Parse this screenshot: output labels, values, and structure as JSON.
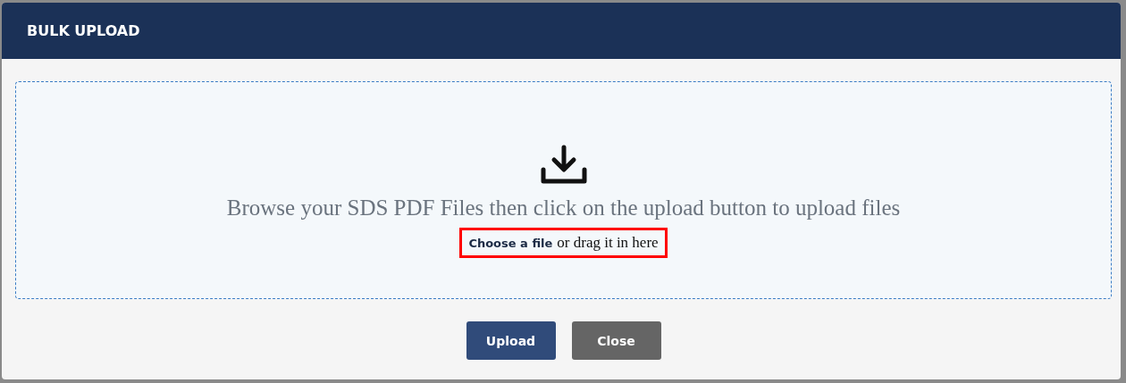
{
  "dialog": {
    "title": "BULK UPLOAD"
  },
  "dropzone": {
    "instruction": "Browse your SDS PDF Files then click on the upload button to upload files",
    "choose_link": "Choose a file",
    "drag_text": "or drag it in here"
  },
  "buttons": [
    {
      "label": "Upload",
      "kind": "primary"
    },
    {
      "label": "Close",
      "kind": "secondary"
    }
  ]
}
